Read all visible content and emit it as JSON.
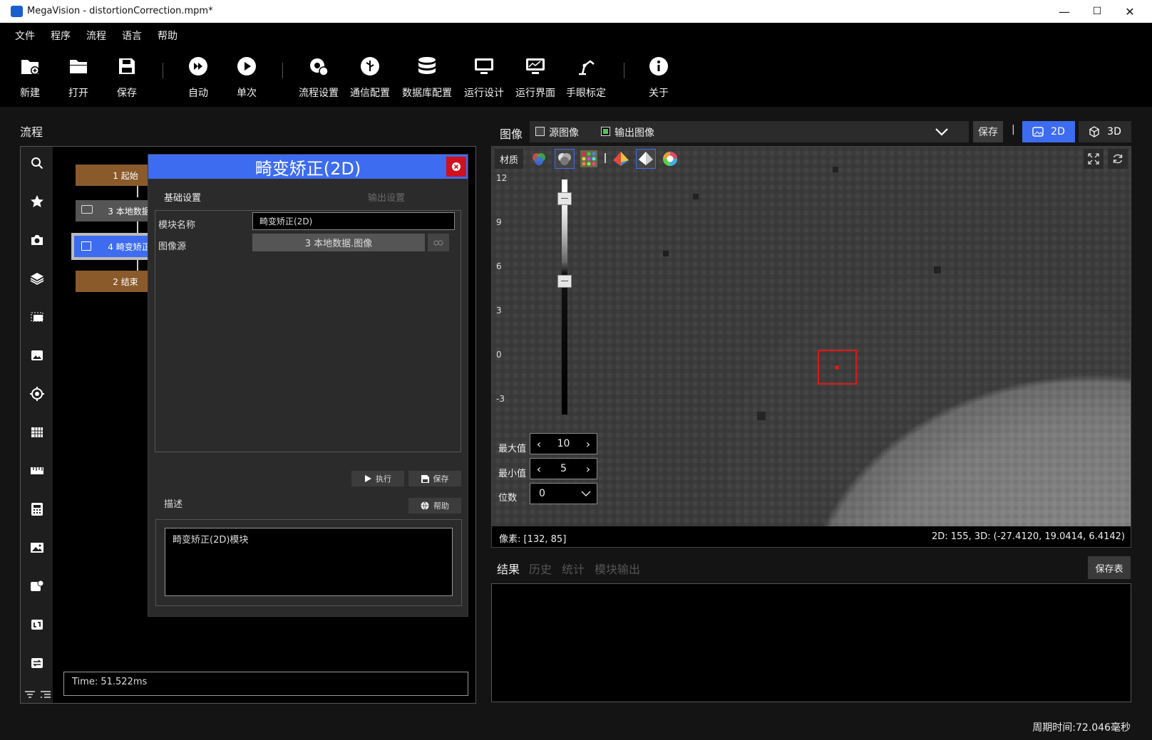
{
  "window": {
    "title": "MegaVision - distortionCorrection.mpm*",
    "min": "—",
    "max": "☐",
    "close": "✕"
  },
  "menu": [
    "文件",
    "程序",
    "流程",
    "语言",
    "帮助"
  ],
  "toolbar": {
    "new": "新建",
    "open": "打开",
    "save": "保存",
    "auto": "自动",
    "single": "单次",
    "flow_settings": "流程设置",
    "comm_config": "通信配置",
    "db_config": "数据库配置",
    "run_design": "运行设计",
    "run_ui": "运行界面",
    "hand_eye": "手眼标定",
    "about": "关于"
  },
  "flow": {
    "title": "流程",
    "nodes": [
      "1 起始",
      "3 本地数据",
      "4 畸变矫正",
      "2 结束"
    ],
    "time": "Time: 51.522ms"
  },
  "dialog": {
    "title": "畸变矫正(2D)",
    "tab_basic": "基础设置",
    "tab_output": "输出设置",
    "module_name_label": "模块名称",
    "module_name_value": "畸变矫正(2D)",
    "image_source_label": "图像源",
    "image_source_value": "3 本地数据.图像",
    "execute": "执行",
    "save": "保存",
    "desc_label": "描述",
    "help": "帮助",
    "desc_text": "畸变矫正(2D)模块"
  },
  "image": {
    "label": "图像",
    "src_image": "源图像",
    "out_image": "输出图像",
    "save": "保存",
    "sep": "|",
    "mode_2d": "2D",
    "mode_3d": "3D",
    "material": "材质",
    "scale_ticks": [
      "12",
      "9",
      "6",
      "3",
      "0",
      "-3"
    ],
    "max_label": "最大值",
    "max_value": "10",
    "min_label": "最小值",
    "min_value": "5",
    "digits_label": "位数",
    "digits_value": "0",
    "pixel": "像素: [132, 85]",
    "coords": "2D: 155, 3D: (-27.4120, 19.0414, 6.4142)"
  },
  "result": {
    "tabs": [
      "结果",
      "历史",
      "统计",
      "模块输出"
    ],
    "save_table": "保存表"
  },
  "status": {
    "cycle": "周期时间:72.046毫秒"
  },
  "colors": {
    "accent": "#3d6cf0",
    "node_brown": "#8a5a2b",
    "node_gray": "#555555",
    "close_red": "#d0101e",
    "marker": "#e01818"
  }
}
